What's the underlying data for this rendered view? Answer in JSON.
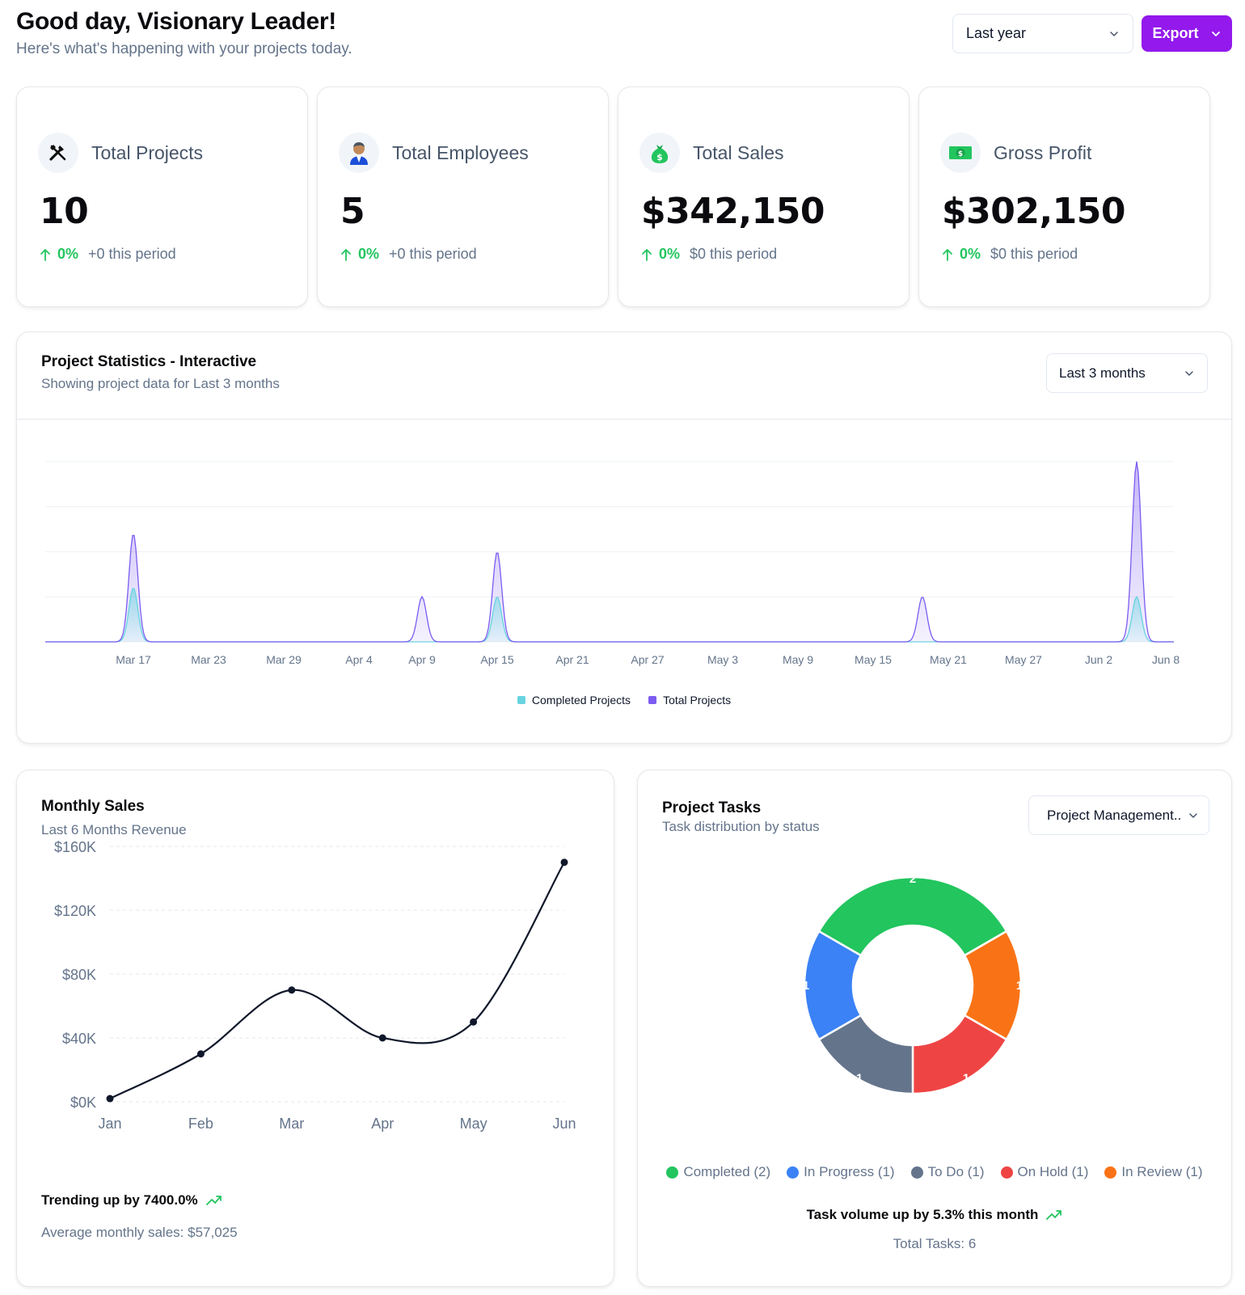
{
  "header": {
    "greeting": "Good day, Visionary Leader!",
    "subtitle": "Here's what's happening with your projects today.",
    "period": "Last year",
    "export_label": "Export"
  },
  "stats": [
    {
      "title": "Total Projects",
      "value": "10",
      "pct": "0%",
      "period": "+0 this period",
      "icon": "tools-icon"
    },
    {
      "title": "Total Employees",
      "value": "5",
      "pct": "0%",
      "period": "+0 this period",
      "icon": "employee-icon"
    },
    {
      "title": "Total Sales",
      "value": "$342,150",
      "pct": "0%",
      "period": "$0 this period",
      "icon": "money-bag-icon"
    },
    {
      "title": "Gross Profit",
      "value": "$302,150",
      "pct": "0%",
      "period": "$0 this period",
      "icon": "banknote-icon"
    }
  ],
  "project_stats": {
    "title": "Project Statistics - Interactive",
    "subtitle": "Showing project data for Last 3 months",
    "range": "Last 3 months"
  },
  "monthly_sales": {
    "title": "Monthly Sales",
    "subtitle": "Last 6 Months Revenue",
    "trend": "Trending up by 7400.0%",
    "average": "Average monthly sales: $57,025"
  },
  "project_tasks": {
    "title": "Project Tasks",
    "subtitle": "Task distribution by status",
    "filter": "Project Management..",
    "trend": "Task volume up by 5.3% this month",
    "total": "Total Tasks: 6"
  },
  "colors": {
    "accent": "#9319ec",
    "positive": "#22c55e",
    "completed_projects": "#67d4df",
    "total_projects": "#7c5cf0"
  },
  "chart_data": [
    {
      "type": "area",
      "x_ticks": [
        "Mar 17",
        "Mar 23",
        "Mar 29",
        "Apr 4",
        "Apr 9",
        "Apr 15",
        "Apr 21",
        "Apr 27",
        "May 3",
        "May 9",
        "May 15",
        "May 21",
        "May 27",
        "Jun 2",
        "Jun 8"
      ],
      "series": [
        {
          "name": "Completed Projects",
          "color": "#67d4df",
          "points": [
            [
              "Mar 17",
              1.2
            ],
            [
              "Apr 15",
              1
            ],
            [
              "Jun 4",
              1
            ]
          ]
        },
        {
          "name": "Total Projects",
          "color": "#7c5cf0",
          "points": [
            [
              "Mar 17",
              2.4
            ],
            [
              "Apr 10",
              1
            ],
            [
              "Apr 15",
              2
            ],
            [
              "May 20",
              1
            ],
            [
              "Jun 4",
              4
            ]
          ]
        }
      ],
      "ylim": [
        0,
        4
      ],
      "grid": true,
      "legend": "bottom"
    },
    {
      "type": "line",
      "categories": [
        "Jan",
        "Feb",
        "Mar",
        "Apr",
        "May",
        "Jun"
      ],
      "values": [
        2000,
        30000,
        70000,
        40000,
        50000,
        150000
      ],
      "y_ticks": [
        "$0K",
        "$40K",
        "$80K",
        "$120K",
        "$160K"
      ],
      "ylim": [
        0,
        160000
      ],
      "grid": true
    },
    {
      "type": "pie",
      "categories": [
        "Completed",
        "In Progress",
        "To Do",
        "On Hold",
        "In Review"
      ],
      "values": [
        2,
        1,
        1,
        1,
        1
      ],
      "colors": [
        "#22c55e",
        "#3b82f6",
        "#64748b",
        "#ef4444",
        "#f97316"
      ],
      "legend_labels": [
        "Completed (2)",
        "In Progress (1)",
        "To Do (1)",
        "On Hold (1)",
        "In Review (1)"
      ],
      "legend": "bottom"
    }
  ]
}
